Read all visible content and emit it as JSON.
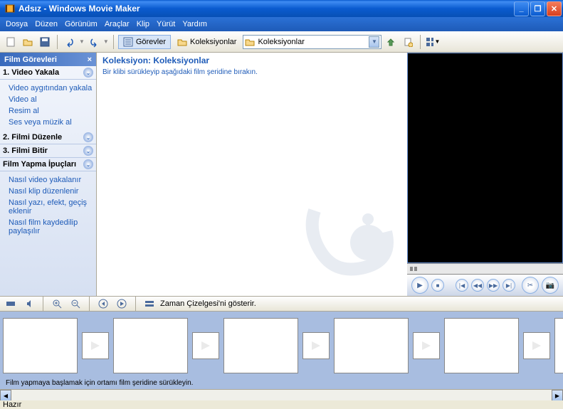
{
  "window": {
    "title": "Adsız - Windows Movie Maker"
  },
  "menu": {
    "dosya": "Dosya",
    "duzen": "Düzen",
    "gorunum": "Görünüm",
    "araclar": "Araçlar",
    "klip": "Klip",
    "yurut": "Yürüt",
    "yardim": "Yardım"
  },
  "toolbar": {
    "gorevler": "Görevler",
    "koleksiyonlar": "Koleksiyonlar",
    "dropdown": "Koleksiyonlar"
  },
  "tasks": {
    "header": "Film Görevleri",
    "sec1": "1. Video Yakala",
    "links1": {
      "a": "Video aygıtından yakala",
      "b": "Video al",
      "c": "Resim al",
      "d": "Ses veya müzik al"
    },
    "sec2": "2. Filmi Düzenle",
    "sec3": "3. Filmi Bitir",
    "sec4": "Film Yapma İpuçları",
    "links4": {
      "a": "Nasıl video yakalanır",
      "b": "Nasıl klip düzenlenir",
      "c": "Nasıl yazı, efekt, geçiş eklenir",
      "d": "Nasıl film kaydedilip paylaşılır"
    }
  },
  "collection": {
    "title": "Koleksiyon: Koleksiyonlar",
    "hint": "Bir klibi sürükleyip aşağıdaki film şeridine bırakın."
  },
  "timeline": {
    "tooltip": "Zaman Çizelgesi'ni gösterir.",
    "hint": "Film yapmaya başlamak için ortamı film şeridine sürükleyin."
  },
  "status": {
    "text": "Hazır"
  }
}
